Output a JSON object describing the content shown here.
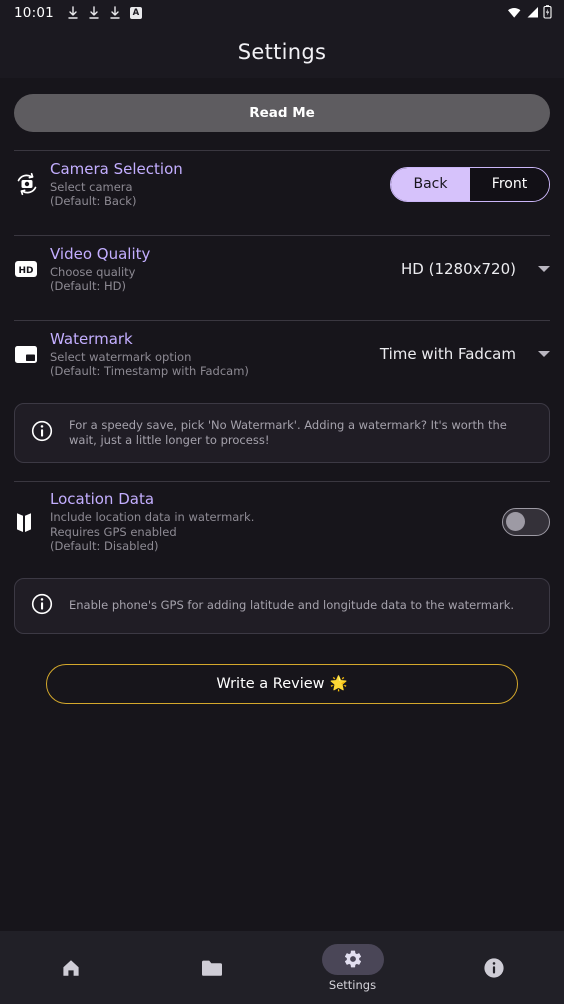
{
  "statusbar": {
    "time": "10:01",
    "left_icons": [
      "download-icon",
      "download-icon",
      "download-icon",
      "app-badge-a-icon"
    ],
    "badge_letter": "A",
    "right_icons": [
      "wifi-icon",
      "cellular-signal-icon",
      "battery-charging-icon"
    ]
  },
  "header": {
    "title": "Settings"
  },
  "readme": {
    "label": "Read Me"
  },
  "settings": {
    "camera": {
      "icon": "camera-switch-icon",
      "title": "Camera Selection",
      "sub1": "Select camera",
      "sub2": "(Default: Back)",
      "options": [
        "Back",
        "Front"
      ],
      "selected": "Back"
    },
    "quality": {
      "icon": "hd-badge-icon",
      "title": "Video Quality",
      "sub1": "Choose quality",
      "sub2": "(Default: HD)",
      "value": "HD (1280x720)"
    },
    "watermark": {
      "icon": "watermark-icon",
      "title": "Watermark",
      "sub1": "Select watermark option",
      "sub2": "(Default: Timestamp with Fadcam)",
      "value": "Time with Fadcam"
    },
    "watermark_note": "For a speedy save, pick 'No Watermark'. Adding a watermark? It's worth the wait, just a little longer to process!",
    "location": {
      "icon": "map-icon",
      "title": "Location Data",
      "sub1": "Include location data in watermark.",
      "sub2": "Requires GPS enabled",
      "sub3": "(Default: Disabled)",
      "enabled": false
    },
    "location_note": "Enable phone's GPS for adding latitude and longitude data to the watermark."
  },
  "review": {
    "label": "Write a Review",
    "emoji": "🌟"
  },
  "bottomnav": {
    "items": [
      {
        "icon": "home-icon",
        "label": "",
        "active": false
      },
      {
        "icon": "folder-icon",
        "label": "",
        "active": false
      },
      {
        "icon": "gear-icon",
        "label": "Settings",
        "active": true
      },
      {
        "icon": "info-icon",
        "label": "",
        "active": false
      }
    ]
  },
  "colors": {
    "background": "#17151b",
    "accent_purple": "#c3aeff",
    "segment_selected": "#d6c2fb",
    "review_border": "#d4a82c",
    "surface": "#201d25"
  }
}
